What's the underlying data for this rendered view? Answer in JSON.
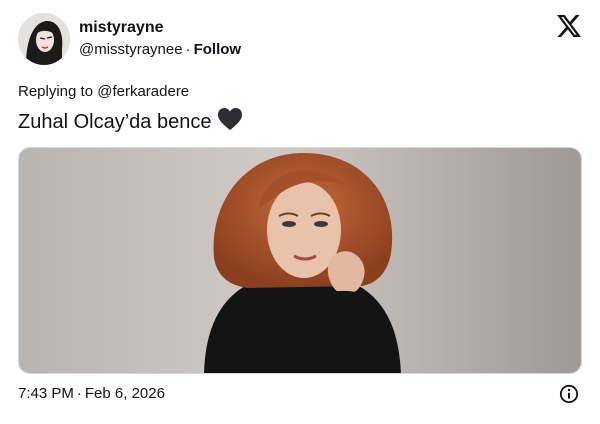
{
  "author": {
    "display_name": "mistyrayne",
    "handle": "@misstyraynee",
    "separator": "·",
    "follow_label": "Follow"
  },
  "reply": {
    "prefix": "Replying to",
    "mention": "@ferkaradere"
  },
  "tweet": {
    "text": "Zuhal Olcay’da bence",
    "emoji": "black-heart"
  },
  "media": {
    "alt": "Portrait photo of a woman with auburn hair in a black turtleneck"
  },
  "footer": {
    "time": "7:43 PM",
    "separator": "·",
    "date": "Feb 6, 2026"
  },
  "icons": {
    "brand": "x-logo-icon",
    "info": "info-icon"
  }
}
